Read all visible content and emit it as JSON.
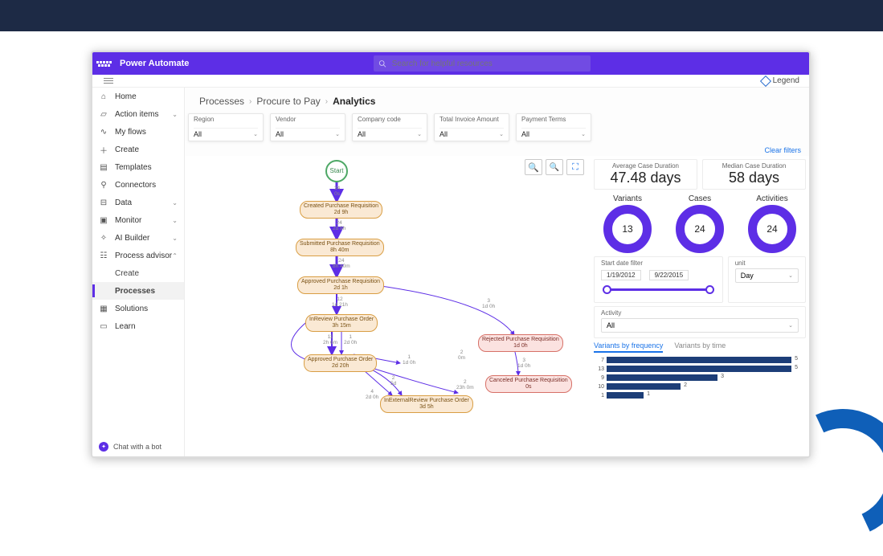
{
  "app": {
    "title": "Power Automate",
    "search_placeholder": "Search for helpful resources"
  },
  "subbar": {
    "legend": "Legend"
  },
  "sidebar": {
    "items": [
      {
        "label": "Home"
      },
      {
        "label": "Action items"
      },
      {
        "label": "My flows"
      },
      {
        "label": "Create"
      },
      {
        "label": "Templates"
      },
      {
        "label": "Connectors"
      },
      {
        "label": "Data"
      },
      {
        "label": "Monitor"
      },
      {
        "label": "AI Builder"
      },
      {
        "label": "Process advisor"
      },
      {
        "label": "Create"
      },
      {
        "label": "Processes"
      },
      {
        "label": "Solutions"
      },
      {
        "label": "Learn"
      }
    ],
    "chatbot": "Chat with a bot"
  },
  "breadcrumb": {
    "a": "Processes",
    "b": "Procure to Pay",
    "c": "Analytics"
  },
  "filters": [
    {
      "label": "Region",
      "value": "All"
    },
    {
      "label": "Vendor",
      "value": "All"
    },
    {
      "label": "Company code",
      "value": "All"
    },
    {
      "label": "Total Invoice Amount",
      "value": "All"
    },
    {
      "label": "Payment Terms",
      "value": "All"
    }
  ],
  "clear_filters": "Clear filters",
  "metrics": {
    "avg_label": "Average Case Duration",
    "avg_value": "47.48 days",
    "med_label": "Median Case Duration",
    "med_value": "58 days"
  },
  "donuts": {
    "variants_label": "Variants",
    "variants_value": "13",
    "cases_label": "Cases",
    "cases_value": "24",
    "activities_label": "Activities",
    "activities_value": "24"
  },
  "date_filter": {
    "label": "Start date filter",
    "from": "1/19/2012",
    "to": "9/22/2015"
  },
  "unit": {
    "label": "unit",
    "value": "Day"
  },
  "activity": {
    "label": "Activity",
    "value": "All"
  },
  "variant_tabs": {
    "freq": "Variants by frequency",
    "time": "Variants by time"
  },
  "flow": {
    "start": "Start",
    "n1": {
      "t": "Created Purchase Requisition",
      "d": "2d 9h"
    },
    "n2": {
      "t": "Submitted Purchase Requisition",
      "d": "8h 40m"
    },
    "n3": {
      "t": "Approved Purchase Requisition",
      "d": "2d 1h"
    },
    "n4": {
      "t": "InReview Purchase Order",
      "d": "3h 15m"
    },
    "n5": {
      "t": "Approved Purchase Order",
      "d": "2d 20h"
    },
    "n6": {
      "t": "InExternalReview Purchase Order",
      "d": "3d 5h"
    },
    "n7": {
      "t": "Rejected Purchase Requisition",
      "d": "1d 0h"
    },
    "n8": {
      "t": "Canceled Purchase Requisition",
      "d": "0s"
    },
    "e1": {
      "c": "24",
      "d": "0s"
    },
    "e2": {
      "c": "24",
      "d": "2d 9h"
    },
    "e3": {
      "c": "24",
      "d": "8h 40m"
    },
    "e4": {
      "c": "12",
      "d": "1d 21h"
    },
    "e5": {
      "c": "3",
      "d": "1d 0h"
    },
    "e5b": {
      "c": "3",
      "d": "1d 0h"
    },
    "e6a": {
      "c": "11",
      "d": "2h 6m"
    },
    "e6b": {
      "c": "1",
      "d": "2d 0h"
    },
    "e7": {
      "c": "1",
      "d": "1d 0h"
    },
    "e8": {
      "c": "2",
      "d": "5d"
    },
    "e9": {
      "c": "2",
      "d": "0m"
    },
    "e10": {
      "c": "4",
      "d": "2d 0h"
    },
    "e11": {
      "c": "2",
      "d": "23h 0m"
    }
  },
  "chart_data": {
    "type": "bar",
    "categories": [
      "7",
      "13",
      "9",
      "10",
      "1"
    ],
    "values": [
      5,
      5,
      3,
      2,
      1
    ],
    "title": "Variants by frequency"
  }
}
